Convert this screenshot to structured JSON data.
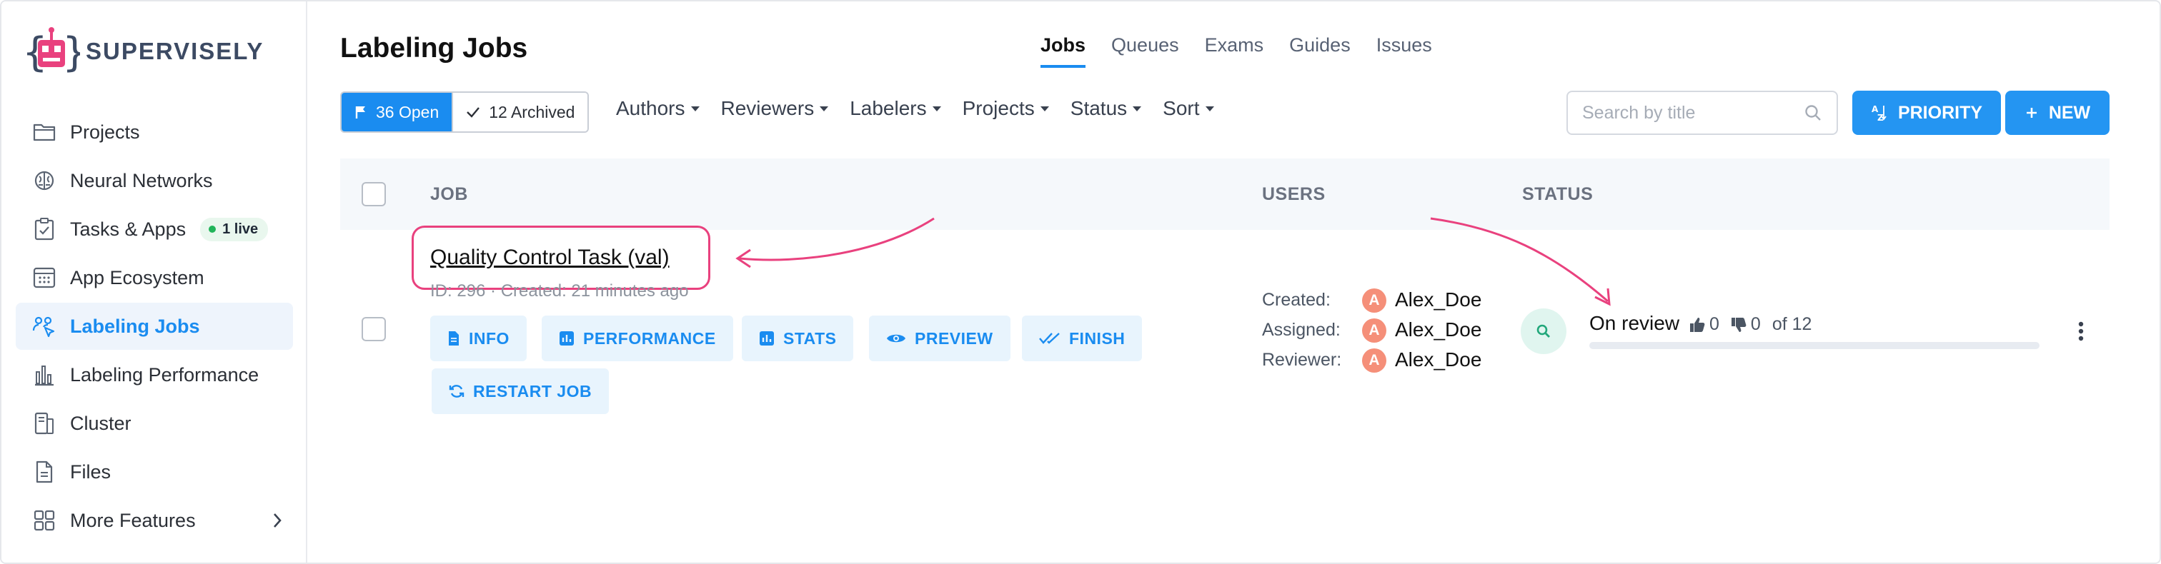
{
  "app": {
    "name": "SUPERVISELY"
  },
  "sidebar": {
    "items": [
      {
        "label": "Projects",
        "icon": "folder-icon"
      },
      {
        "label": "Neural Networks",
        "icon": "brain-icon"
      },
      {
        "label": "Tasks & Apps",
        "icon": "clipboard-check-icon",
        "badge": "1 live"
      },
      {
        "label": "App Ecosystem",
        "icon": "app-grid-icon"
      },
      {
        "label": "Labeling Jobs",
        "icon": "labeling-users-icon",
        "active": true
      },
      {
        "label": "Labeling Performance",
        "icon": "bar-chart-icon"
      },
      {
        "label": "Cluster",
        "icon": "server-icon"
      },
      {
        "label": "Files",
        "icon": "file-icon"
      },
      {
        "label": "More Features",
        "icon": "grid-icon"
      }
    ]
  },
  "header": {
    "title": "Labeling Jobs",
    "tabs": [
      {
        "label": "Jobs",
        "active": true
      },
      {
        "label": "Queues"
      },
      {
        "label": "Exams"
      },
      {
        "label": "Guides"
      },
      {
        "label": "Issues"
      }
    ]
  },
  "toolbar": {
    "open_label": "36 Open",
    "archived_label": "12 Archived",
    "filters": [
      "Authors",
      "Reviewers",
      "Labelers",
      "Projects",
      "Status",
      "Sort"
    ],
    "search_placeholder": "Search by title",
    "priority_label": "PRIORITY",
    "new_label": "NEW"
  },
  "table": {
    "headers": {
      "job": "JOB",
      "users": "USERS",
      "status": "STATUS"
    },
    "rows": [
      {
        "title": "Quality Control Task (val)",
        "meta": "ID: 296 · Created: 21 minutes ago",
        "actions": [
          "INFO",
          "PERFORMANCE",
          "STATS",
          "PREVIEW",
          "FINISH",
          "RESTART JOB"
        ],
        "users": {
          "created_label": "Created:",
          "created": "Alex_Doe",
          "assigned_label": "Assigned:",
          "assigned": "Alex_Doe",
          "reviewer_label": "Reviewer:",
          "reviewer": "Alex_Doe",
          "avatar_letter": "A"
        },
        "status": {
          "text": "On review",
          "likes": "0",
          "dislikes": "0",
          "of_total": "of 12",
          "progress": 0
        }
      }
    ]
  },
  "colors": {
    "accent": "#1a8cf0",
    "highlight": "#e9417e",
    "brand": "#e9417e",
    "avatar": "#f58f79"
  }
}
